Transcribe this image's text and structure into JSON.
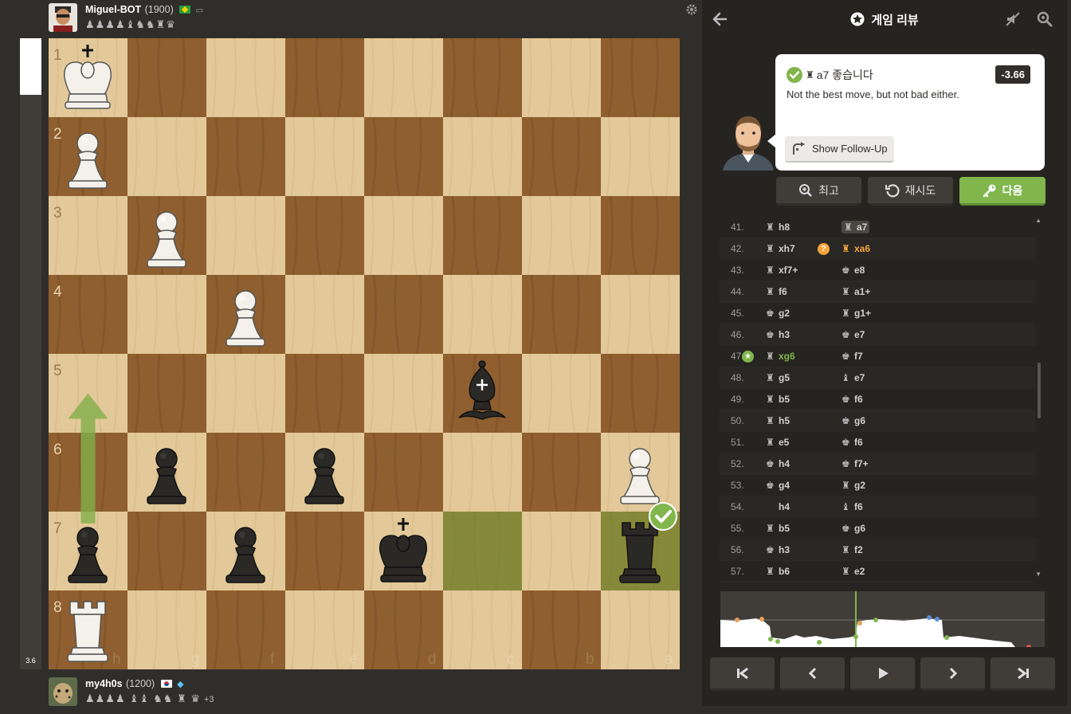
{
  "top_player": {
    "name": "Miguel-BOT",
    "rating": "(1900)",
    "captured": "♟♟♟♟♝♞♞♜♛"
  },
  "bottom_player": {
    "name": "my4h0s",
    "rating": "(1200)",
    "captured": "♟♟♟♟ ♝♝ ♞♞ ♜ ♛",
    "advantage": "+3"
  },
  "eval_bar": {
    "label": "3.6",
    "white_fraction": 0.09
  },
  "board": {
    "rank_labels": [
      "1",
      "2",
      "3",
      "4",
      "5",
      "6",
      "7",
      "8"
    ],
    "file_labels": [
      "h",
      "g",
      "f",
      "e",
      "d",
      "c",
      "b",
      "a"
    ],
    "orientation": "black",
    "pieces": [
      {
        "square": "h1",
        "piece": "wK"
      },
      {
        "square": "h2",
        "piece": "wP"
      },
      {
        "square": "g3",
        "piece": "wP"
      },
      {
        "square": "f4",
        "piece": "wP"
      },
      {
        "square": "c5",
        "piece": "bB"
      },
      {
        "square": "g6",
        "piece": "bP"
      },
      {
        "square": "e6",
        "piece": "bP"
      },
      {
        "square": "a6",
        "piece": "wP"
      },
      {
        "square": "h7",
        "piece": "bP"
      },
      {
        "square": "f7",
        "piece": "bP"
      },
      {
        "square": "d7",
        "piece": "bK"
      },
      {
        "square": "a7",
        "piece": "bR"
      },
      {
        "square": "h8",
        "piece": "wR"
      }
    ],
    "highlighted_squares": [
      "c7",
      "a7"
    ],
    "arrow": {
      "from": "h7",
      "to": "h5"
    }
  },
  "panel": {
    "title": "게임 리뷰",
    "coach": {
      "move": "a7 좋습니다",
      "message": "Not the best move, but not bad either.",
      "eval": "-3.66",
      "follow_up": "Show Follow-Up"
    },
    "buttons": {
      "best": "최고",
      "retry": "재시도",
      "next": "다음"
    },
    "moves": [
      {
        "n": "41.",
        "w": "h8",
        "wp": "♜",
        "b": "a7",
        "bp": "♜",
        "bhl": true
      },
      {
        "n": "42.",
        "w": "xh7",
        "wp": "♜",
        "b": "xa6",
        "bp": "♜",
        "btag": "?",
        "bmist": true
      },
      {
        "n": "43.",
        "w": "xf7+",
        "wp": "♜",
        "b": "e8",
        "bp": "♚"
      },
      {
        "n": "44.",
        "w": "f6",
        "wp": "♜",
        "b": "a1+",
        "bp": "♜"
      },
      {
        "n": "45.",
        "w": "g2",
        "wp": "♚",
        "b": "g1+",
        "bp": "♜"
      },
      {
        "n": "46.",
        "w": "h3",
        "wp": "♚",
        "b": "e7",
        "bp": "♚"
      },
      {
        "n": "47.",
        "w": "xg6",
        "wp": "♜",
        "b": "f7",
        "bp": "♚",
        "wtag": "★",
        "wgood": true
      },
      {
        "n": "48.",
        "w": "g5",
        "wp": "♜",
        "b": "e7",
        "bp": "♝"
      },
      {
        "n": "49.",
        "w": "b5",
        "wp": "♜",
        "b": "f6",
        "bp": "♚"
      },
      {
        "n": "50.",
        "w": "h5",
        "wp": "♜",
        "b": "g6",
        "bp": "♚"
      },
      {
        "n": "51.",
        "w": "e5",
        "wp": "♜",
        "b": "f6",
        "bp": "♚"
      },
      {
        "n": "52.",
        "w": "h4",
        "wp": "♚",
        "b": "f7+",
        "bp": "♚"
      },
      {
        "n": "53.",
        "w": "g4",
        "wp": "♚",
        "b": "g2",
        "bp": "♜"
      },
      {
        "n": "54.",
        "w": "h4",
        "wp": "",
        "b": "f6",
        "bp": "♝"
      },
      {
        "n": "55.",
        "w": "b5",
        "wp": "♜",
        "b": "g6",
        "bp": "♚"
      },
      {
        "n": "56.",
        "w": "h3",
        "wp": "♚",
        "b": "f2",
        "bp": "♜"
      },
      {
        "n": "57.",
        "w": "b6",
        "wp": "♜",
        "b": "e2",
        "bp": "♜"
      }
    ]
  },
  "colors": {
    "light_square": "#e3c99a",
    "dark_square": "#8f5f30",
    "accent_green": "#81b64c",
    "highlight": "rgba(130,151,60,0.75)"
  }
}
